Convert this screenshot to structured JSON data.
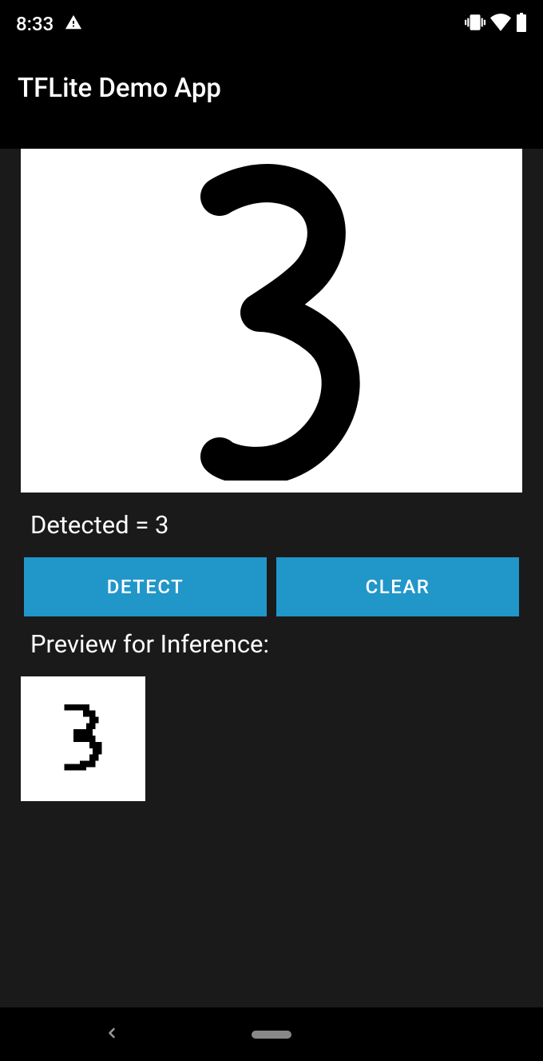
{
  "status_bar": {
    "time": "8:33"
  },
  "app": {
    "title": "TFLite Demo App"
  },
  "main": {
    "detected_label": "Detected = 3",
    "detect_button": "DETECT",
    "clear_button": "CLEAR",
    "preview_label": "Preview for Inference:",
    "drawn_digit": "3"
  },
  "colors": {
    "button_bg": "#2196c9",
    "content_bg": "#1a1a1a"
  }
}
